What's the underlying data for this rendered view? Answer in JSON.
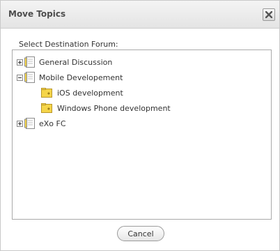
{
  "dialog": {
    "title": "Move Topics",
    "close_icon": "close-icon"
  },
  "label": "Select Destination Forum:",
  "tree": {
    "categories": [
      {
        "label": "General Discussion",
        "expanded": false
      },
      {
        "label": "Mobile Developement",
        "expanded": true,
        "forums": [
          {
            "label": "iOS development"
          },
          {
            "label": "Windows Phone development"
          }
        ]
      },
      {
        "label": "eXo FC",
        "expanded": false
      }
    ]
  },
  "buttons": {
    "cancel": "Cancel"
  },
  "colors": {
    "folder_yellow": "#f5d54a",
    "border": "#a9a9a9"
  }
}
